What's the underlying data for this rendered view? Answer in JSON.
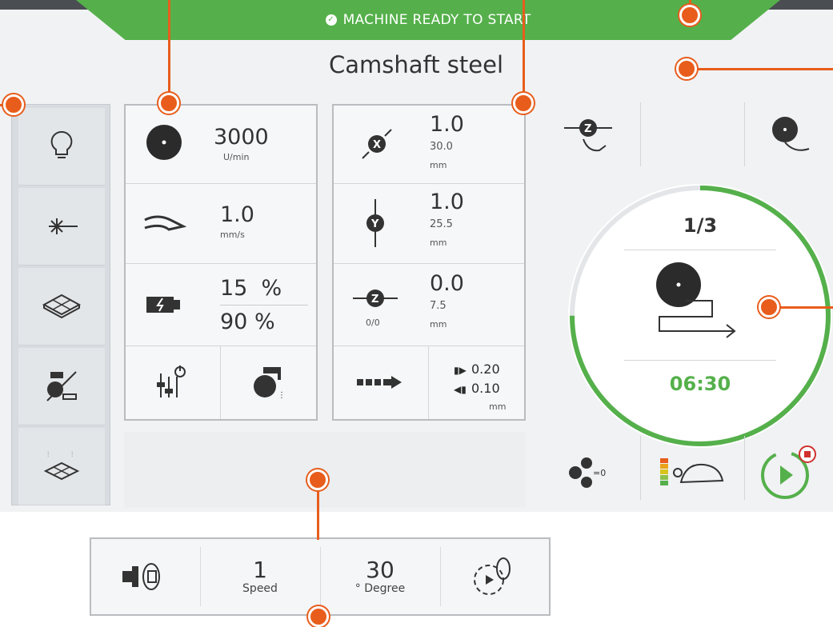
{
  "status": {
    "text": "MACHINE READY TO START",
    "icon": "check-circle-icon"
  },
  "title": "Camshaft steel",
  "sidebar": {
    "items": [
      {
        "icon": "bulb-icon"
      },
      {
        "icon": "laser-icon"
      },
      {
        "icon": "grid-table-icon"
      },
      {
        "icon": "coolant-off-icon"
      },
      {
        "icon": "table-spray-icon"
      }
    ]
  },
  "left_panel": {
    "speed": {
      "value": "3000",
      "unit": "U/min"
    },
    "feed": {
      "value": "1.0",
      "unit": "mm/s"
    },
    "load": {
      "value1": "15  %",
      "value2": "90 %"
    }
  },
  "axis_panel": {
    "x": {
      "value": "1.0",
      "sub": "30.0",
      "unit": "mm"
    },
    "y": {
      "value": "1.0",
      "sub": "25.5",
      "unit": "mm"
    },
    "z": {
      "value": "0.0",
      "sub": "7.5",
      "unit": "mm",
      "counter": "0/0"
    },
    "infeed": {
      "fwd": "0.20",
      "back": "0.10",
      "unit": "mm"
    }
  },
  "cycle": {
    "step": "1/3",
    "time": "06:30",
    "progress": 0.75
  },
  "bottom": {
    "speed_value": "1",
    "speed_label": "Speed",
    "degree_value": "30",
    "degree_label": "° Degree"
  },
  "colors": {
    "accent_green": "#55b04b",
    "annotation": "#e85d1c"
  }
}
